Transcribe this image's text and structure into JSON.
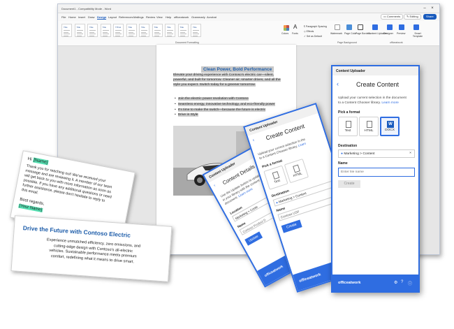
{
  "word": {
    "title": "Document1 - Compatibility Mode - Word",
    "tabs": [
      "File",
      "Home",
      "Insert",
      "Draw",
      "Design",
      "Layout",
      "References",
      "Mailings",
      "Review",
      "View",
      "Help",
      "officeatwork",
      "Grammarly",
      "Acrobat"
    ],
    "active_tab": "Design",
    "comments_label": "Comments",
    "editing_label": "Editing",
    "share_label": "Share",
    "formatting_label": "Document Formatting",
    "colors_label": "Colors",
    "fonts_label": "Fonts",
    "paragraph_spacing_label": "Paragraph Spacing",
    "effects_label": "Effects",
    "set_default_label": "Set as Default",
    "watermark_label": "Watermark",
    "page_color_label": "Page Color",
    "page_borders_label": "Page Borders",
    "page_background_label": "Page Background",
    "content_uploader_label": "Content Uploader",
    "designer_label": "Designer",
    "preview_label": "Preview",
    "smart_template_label": "Smart Template",
    "group_label": "officeatwork",
    "style_titles": [
      "Title",
      "Title",
      "Title",
      "Title",
      "TITLE",
      "Title",
      "Title",
      "Title",
      "Title",
      "Title",
      "Title"
    ]
  },
  "document": {
    "heading": "Clean Power, Bold Performance",
    "paragraph_lines": [
      "Elevate your driving experience with Contoso's electric car—silent,",
      "powerful, and built for tomorrow. Cleaner air, smarter drives, and all the",
      "style you expect. Switch today for a greener tomorrow."
    ],
    "bullets": [
      "Join the electric power revolution with Contoso",
      "Seamless energy, innovative technology, and eco-friendly power",
      "It's time to make the switch—because the future is electric",
      "Drive in Style"
    ]
  },
  "email_note": {
    "greeting": "Hi",
    "name_tag": "[Name]",
    "lines": [
      "Thank you for reaching out! We've received your",
      "message and are reviewing it. A member of our team",
      "will get back to you with more information as soon as",
      "possible. If you have any additional questions or need",
      "further assistance, please don't hesitate to reply to",
      "this email."
    ],
    "signoff": "Best regards,",
    "signature_tag": "[Your Name]"
  },
  "ad_note": {
    "headline": "Drive the Future with Contoso Electric",
    "body_lines": [
      "Experience unmatched efficiency, zero emissions, and",
      "cutting-edge design with Contoso's all-electric",
      "vehicles. Sustainable performance meets premium",
      "comfort, redefining what it means to drive smart."
    ]
  },
  "uploader": {
    "app_title": "Content Uploader",
    "heading": "Create Content",
    "description_line1": "Upload your current selection in the document",
    "description_line2": "to a Content Chooser library.",
    "learn_more": "Learn more",
    "format_label": "Pick a format",
    "formats": [
      "Text",
      "HTML",
      "DOCX"
    ],
    "selected_format": "DOCX",
    "destination_label": "Destination",
    "destination_value": "Marketing > Content",
    "name_label": "Name",
    "name_placeholder": "Enter file name",
    "create_label": "Create",
    "brand": "officeatwork"
  },
  "mid_panel": {
    "app_title": "Content Uploader",
    "heading": "Create Content",
    "description_line1": "Upload your current selection in the",
    "description_line2": "to a Content Chooser library.",
    "learn_more": "Learn",
    "format_label": "Pick a format",
    "formats": [
      "Text",
      "HTML"
    ],
    "destination_label": "Destination",
    "destination_value": "Marketing > Content",
    "name_label": "Name",
    "name_value": "Contoso USP",
    "create_label": "Create",
    "brand": "officeatwork"
  },
  "back_panel": {
    "app_title": "Content Uploader",
    "heading": "Content Details",
    "description_line1": "Use the Update button to update the",
    "description_line2": "in your library with the content you",
    "description_line3": "document.",
    "learn_more": "Learn more",
    "location_label": "Location",
    "location_value": "Marketing > Conte",
    "name_label": "Name",
    "name_value": "Contoso Product D",
    "update_label": "Update",
    "brand": "officeatwork"
  },
  "colors": {
    "accent": "#2f6de1",
    "word_blue": "#185abd",
    "heading_blue": "#1f5eaa",
    "tag_green": "#55e0b2",
    "doc_highlight": "#cdcdcd"
  }
}
